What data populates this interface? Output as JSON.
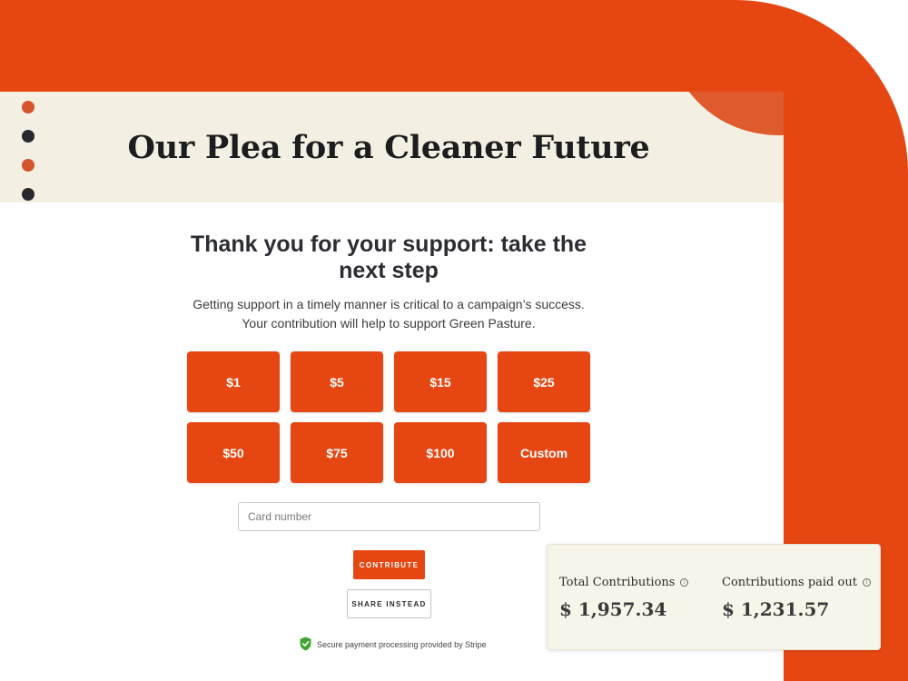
{
  "banner": {
    "title": "Our Plea for a Cleaner Future"
  },
  "main": {
    "heading": "Thank you for your support: take the next step",
    "subtext_line1": "Getting support in a timely manner is critical to a campaign’s success.",
    "subtext_line2": "Your contribution will help to support Green Pasture."
  },
  "amounts": [
    "$1",
    "$5",
    "$15",
    "$25",
    "$50",
    "$75",
    "$100",
    "Custom"
  ],
  "form": {
    "card_placeholder": "Card number",
    "contribute_label": "CONTRIBUTE",
    "share_label": "SHARE INSTEAD",
    "secure_text": "Secure payment processing provided by Stripe"
  },
  "stats": {
    "total_label": "Total Contributions",
    "total_value": "$ 1,957.34",
    "paid_label": "Contributions paid out",
    "paid_value": "$ 1,231.57"
  },
  "colors": {
    "accent": "#e64712",
    "banner_bg": "#f3f0e3",
    "stats_bg": "#f7f5e9",
    "secure_green": "#3fa535"
  },
  "icons": [
    "info-icon",
    "shield-check-icon"
  ]
}
